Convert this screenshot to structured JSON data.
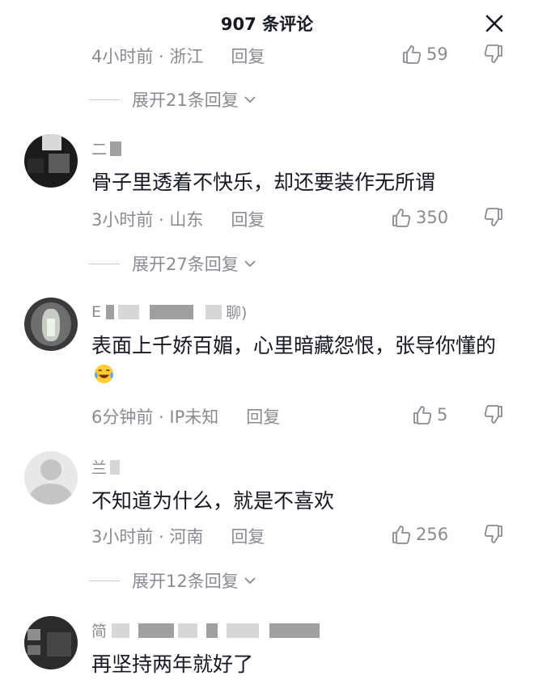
{
  "header": {
    "title": "907 条评论"
  },
  "comments": [
    {
      "meta": "4小时前 · 浙江",
      "reply": "回复",
      "likes": "59",
      "expand": "展开21条回复"
    },
    {
      "name_visible": "二",
      "text": "骨子里透着不快乐，却还要装作无所谓",
      "meta": "3小时前 · 山东",
      "reply": "回复",
      "likes": "350",
      "expand": "展开27条回复"
    },
    {
      "name_visible_start": "E",
      "name_visible_end": "聊)",
      "text": "表面上千娇百媚，心里暗藏怨恨，张导你懂的",
      "meta": "6分钟前 · IP未知",
      "reply": "回复",
      "likes": "5"
    },
    {
      "name_visible": "兰",
      "text": "不知道为什么，就是不喜欢",
      "meta": "3小时前 · 河南",
      "reply": "回复",
      "likes": "256",
      "expand": "展开12条回复"
    },
    {
      "name_visible": "简",
      "text": "再坚持两年就好了"
    }
  ],
  "icons": {
    "close": "close-icon",
    "like": "thumbs-up-icon",
    "dislike": "thumbs-down-icon",
    "chevron": "chevron-down-icon",
    "emoji": "laughing-crying-emoji"
  },
  "colors": {
    "text": "#161823",
    "secondary": "#8a8b91"
  }
}
